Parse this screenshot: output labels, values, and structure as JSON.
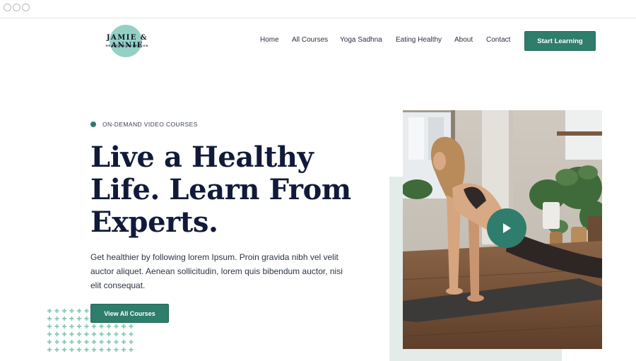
{
  "logo": {
    "name": "JAMIE & ANNIE",
    "tagline": "HEALTH & NUTRITION"
  },
  "nav": {
    "items": [
      "Home",
      "All Courses",
      "Yoga Sadhna",
      "Eating Healthy",
      "About",
      "Contact"
    ],
    "cta_label": "Start Learning"
  },
  "hero": {
    "eyebrow": "ON-DEMAND VIDEO COURSES",
    "headline_line1": "Live a Healthy",
    "headline_line2": "Life. Learn From",
    "headline_line3": "Experts.",
    "body": "Get healthier by following lorem Ipsum. Proin gravida nibh vel velit auctor aliquet. Aenean sollicitudin, lorem quis bibendum auctor, nisi elit consequat.",
    "button_label": "View All Courses"
  },
  "media": {
    "play_icon": "play-icon"
  },
  "colors": {
    "accent": "#2f7d6c",
    "logo_blob": "#8fcdc1",
    "heading": "#121a3a",
    "image_backdrop": "#e3ece8"
  }
}
